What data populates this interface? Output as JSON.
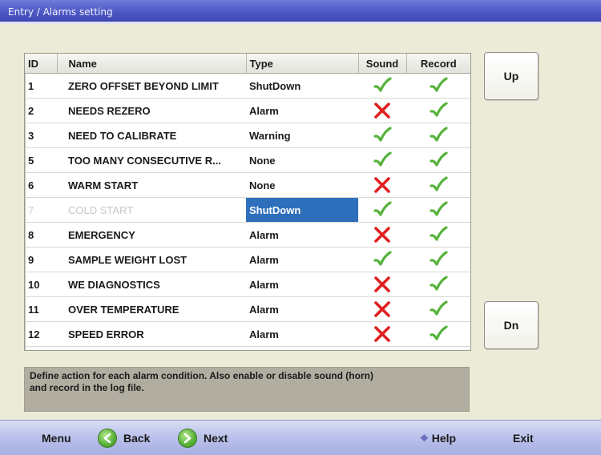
{
  "window": {
    "title": "Entry / Alarms setting"
  },
  "table": {
    "headers": {
      "id": "ID",
      "name": "Name",
      "type": "Type",
      "sound": "Sound",
      "record": "Record"
    },
    "rows": [
      {
        "id": "1",
        "name": "ZERO OFFSET BEYOND LIMIT",
        "type": "ShutDown",
        "sound": true,
        "record": true
      },
      {
        "id": "2",
        "name": "NEEDS REZERO",
        "type": "Alarm",
        "sound": false,
        "record": true
      },
      {
        "id": "3",
        "name": "NEED TO CALIBRATE",
        "type": "Warning",
        "sound": true,
        "record": true
      },
      {
        "id": "5",
        "name": "TOO MANY CONSECUTIVE R...",
        "type": "None",
        "sound": true,
        "record": true
      },
      {
        "id": "6",
        "name": "WARM START",
        "type": "None",
        "sound": false,
        "record": true
      },
      {
        "id": "7",
        "name": "COLD START",
        "type": "ShutDown",
        "sound": true,
        "record": true,
        "disabled": true,
        "selected": true
      },
      {
        "id": "8",
        "name": "EMERGENCY",
        "type": "Alarm",
        "sound": false,
        "record": true
      },
      {
        "id": "9",
        "name": "SAMPLE WEIGHT LOST",
        "type": "Alarm",
        "sound": true,
        "record": true
      },
      {
        "id": "10",
        "name": "WE DIAGNOSTICS",
        "type": "Alarm",
        "sound": false,
        "record": true
      },
      {
        "id": "11",
        "name": "OVER TEMPERATURE",
        "type": "Alarm",
        "sound": false,
        "record": true
      },
      {
        "id": "12",
        "name": "SPEED ERROR",
        "type": "Alarm",
        "sound": false,
        "record": true
      }
    ]
  },
  "side_buttons": {
    "up": "Up",
    "down": "Dn"
  },
  "help_text": "Define action for each alarm condition.  Also enable or disable sound (horn)\nand record in the log file.",
  "bottom_bar": {
    "menu": "Menu",
    "back": "Back",
    "next": "Next",
    "help": "Help",
    "exit": "Exit"
  },
  "icons": {
    "enabled": "check-icon",
    "disabled": "cross-icon",
    "back": "back-arrow-icon",
    "next": "next-arrow-icon",
    "help": "help-icon"
  },
  "colors": {
    "check": "#55b23a",
    "cross": "#e02020",
    "selection": "#2e6fbc",
    "title_bar": "#4a55c2"
  }
}
